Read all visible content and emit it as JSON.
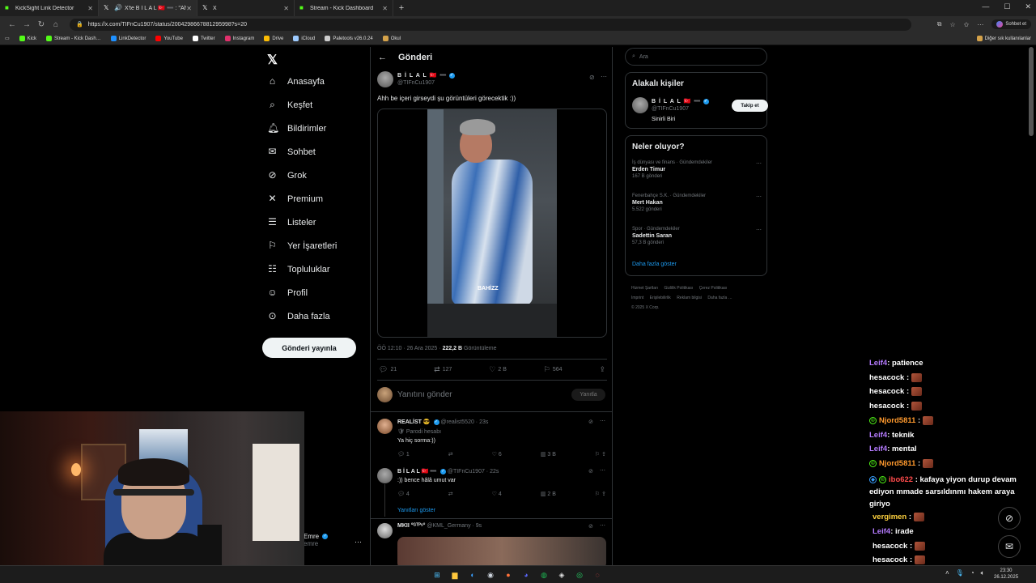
{
  "browser": {
    "tabs": [
      {
        "label": "KickSight Link Detector",
        "icon": "kick-icon"
      },
      {
        "label": "X'te B İ L A L 🇹🇷 ➖ : \"Ahh be iç…",
        "icon": "speaker-icon",
        "active": true
      },
      {
        "label": "X",
        "icon": "x-icon"
      },
      {
        "label": "Stream - Kick Dashboard",
        "icon": "kick-icon"
      }
    ],
    "new_tab": "+",
    "url": "https://x.com/TIFnCu1907/status/2004298667881295998?s=20",
    "copilot_label": "Sohbet et",
    "bookmarks": [
      {
        "label": "Kick",
        "color": "#53fc18"
      },
      {
        "label": "Stream - Kick Dash…",
        "color": "#53fc18"
      },
      {
        "label": "LinkDetector",
        "color": "#1e90ff"
      },
      {
        "label": "YouTube",
        "color": "#ff0000"
      },
      {
        "label": "Twitter",
        "color": "#ffffff"
      },
      {
        "label": "Instagram",
        "color": "#e1306c"
      },
      {
        "label": "Drive",
        "color": "#fbbc04"
      },
      {
        "label": "iCloud",
        "color": "#9ecbff"
      },
      {
        "label": "Paletools v26.0.24",
        "color": "#cccccc"
      },
      {
        "label": "Okul",
        "color": "#d4a24a"
      }
    ],
    "bookmarks_other": "Diğer sık kullanılanlar"
  },
  "nav": {
    "items": [
      {
        "label": "Anasayfa",
        "icon": "home-icon",
        "glyph": "⌂"
      },
      {
        "label": "Keşfet",
        "icon": "search-icon",
        "glyph": "⌕"
      },
      {
        "label": "Bildirimler",
        "icon": "bell-icon",
        "glyph": "♫"
      },
      {
        "label": "Sohbet",
        "icon": "mail-icon",
        "glyph": "✉"
      },
      {
        "label": "Grok",
        "icon": "grok-icon",
        "glyph": "⊘"
      },
      {
        "label": "Premium",
        "icon": "x-premium-icon",
        "glyph": "✕"
      },
      {
        "label": "Listeler",
        "icon": "list-icon",
        "glyph": "☰"
      },
      {
        "label": "Yer İşaretleri",
        "icon": "bookmark-icon",
        "glyph": "⚑"
      },
      {
        "label": "Topluluklar",
        "icon": "communities-icon",
        "glyph": "☷"
      },
      {
        "label": "Profil",
        "icon": "person-icon",
        "glyph": "☺"
      },
      {
        "label": "Daha fazla",
        "icon": "more-circle-icon",
        "glyph": "⊙"
      }
    ],
    "post_button": "Gönderi yayınla",
    "profile_name": "Emre",
    "profile_handle": "emre"
  },
  "main": {
    "title": "Gönderi",
    "post": {
      "author": "B İ L A L 🇹🇷 ➖",
      "handle": "@TIFnCu1907",
      "text": "Ahh be içeri girseydi şu görüntüleri görecektik :))",
      "watermark": "BAHİZZ",
      "time": "ÖÖ 12:10 · 26 Ara 2025 · ",
      "views": "222,2 B",
      "views_label": " Görüntüleme",
      "replies": "21",
      "reposts": "127",
      "likes": "2 B",
      "bookmarks": "564"
    },
    "reply_placeholder": "Yanıtını gönder",
    "reply_button": "Yanıtla",
    "replies": [
      {
        "name": "REALİST 😎",
        "handle": "@realist5520 · 23s",
        "sub": "🛡 Parodi hesabı",
        "text": "Ya hiç sorma:))",
        "r": "1",
        "rt": "",
        "l": "6",
        "v": "3 B"
      },
      {
        "name": "B İ L A L 🇹🇷 ➖",
        "handle": "@TIFnCu1907 · 22s",
        "text": ":)) bence hâlâ umut var",
        "r": "4",
        "rt": "",
        "l": "4",
        "v": "2 B"
      },
      {
        "name": "MKII °ᴳᵀᴾˢ°",
        "handle": "@KML_Germany · 9s"
      }
    ],
    "show_replies": "Yanıtları göster"
  },
  "sidebar": {
    "search_placeholder": "Ara",
    "related_title": "Alakalı kişiler",
    "related": {
      "name": "B İ L A L 🇹🇷 ➖",
      "handle": "@TIFnCu1907",
      "bio": "Sinirli Biri",
      "follow": "Takip et"
    },
    "trends_title": "Neler oluyor?",
    "trends": [
      {
        "meta": "İş dünyası ve finans · Gündemdekiler",
        "name": "Erden Timur",
        "count": "167 B gönderi"
      },
      {
        "meta": "Fenerbahçe S.K. · Gündemdekiler",
        "name": "Mert Hakan",
        "count": "5.522 gönderi"
      },
      {
        "meta": "Spor · Gündemdekiler",
        "name": "Sadettin Saran",
        "count": "57,3 B gönderi"
      }
    ],
    "show_more": "Daha fazla göster",
    "footer": [
      "Hizmet Şartları",
      "Gizlilik Politikası",
      "Çerez Politikası",
      "Imprint",
      "Erişilebilirlik",
      "Reklam bilgisi",
      "Daha fazla …",
      "© 2025 X Corp."
    ]
  },
  "chat": {
    "lines": [
      {
        "user": "Leif4",
        "color": "#b57bff",
        "text": ": patience",
        "emote": false
      },
      {
        "user": "hesacock",
        "color": "#ffffff",
        "text": " :",
        "emote": true
      },
      {
        "user": "hesacock",
        "color": "#ffffff",
        "text": " :",
        "emote": true
      },
      {
        "user": "hesacock",
        "color": "#ffffff",
        "text": " :",
        "emote": true
      },
      {
        "user": "Njord5811",
        "color": "#ff9a2e",
        "text": " :",
        "emote": true,
        "badge": true
      },
      {
        "user": "Leif4",
        "color": "#b57bff",
        "text": ": teknik",
        "emote": false
      },
      {
        "user": "Leif4",
        "color": "#b57bff",
        "text": ": mental",
        "emote": false
      },
      {
        "user": "Njord5811",
        "color": "#ff9a2e",
        "text": " :",
        "emote": true,
        "badge": true
      }
    ],
    "wrap_line": {
      "user": "ibo622",
      "color": "#ff4b4b",
      "text": ": kafaya yiyon durup devam ediyon mmade sarsıldınmı hakem araya giriyo"
    },
    "tail_lines": [
      {
        "user": "vergimen",
        "color": "#ffd23f",
        "text": " :",
        "emote": true
      },
      {
        "user": "Leif4",
        "color": "#b57bff",
        "text": ": irade",
        "emote": false
      },
      {
        "user": "hesacock",
        "color": "#ffffff",
        "text": " :",
        "emote": true
      },
      {
        "user": "hesacock",
        "color": "#ffffff",
        "text": " :",
        "emote": true
      },
      {
        "user": "hesacock",
        "color": "#ffffff",
        "text": " :",
        "emote": true
      }
    ]
  },
  "taskbar": {
    "time": "23:30",
    "date": "26.12.2025"
  }
}
